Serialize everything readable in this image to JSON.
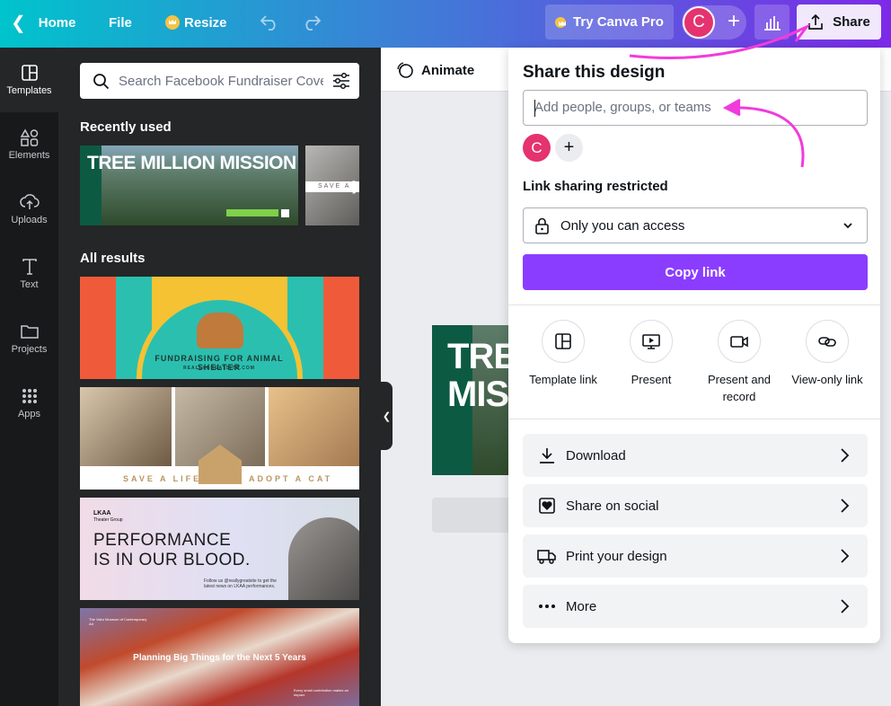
{
  "topbar": {
    "home_label": "Home",
    "file_label": "File",
    "resize_label": "Resize",
    "pro_label": "Try Canva Pro",
    "avatar_initial": "C",
    "share_label": "Share"
  },
  "rail": {
    "items": [
      {
        "label": "Templates",
        "icon": "templates-icon"
      },
      {
        "label": "Elements",
        "icon": "elements-icon"
      },
      {
        "label": "Uploads",
        "icon": "uploads-icon"
      },
      {
        "label": "Text",
        "icon": "text-icon"
      },
      {
        "label": "Projects",
        "icon": "folder-icon"
      },
      {
        "label": "Apps",
        "icon": "apps-grid-icon"
      }
    ]
  },
  "panel": {
    "search_placeholder": "Search Facebook Fundraiser Cove",
    "recent_title": "Recently used",
    "all_title": "All results",
    "recent1_text": "TREE MILLION MISSION",
    "recent2_text": "SAVE A",
    "t1_text": "FUNDRAISING FOR ANIMAL SHELTER",
    "t1_url": "REALLYGREATSITE.COM",
    "t2_left": "SAVE A LIFE",
    "t2_right": "ADOPT A CAT",
    "t3_logo": "LKAA",
    "t3_logo_sub": "Theater Group",
    "t3_headline_1": "PERFORMANCE",
    "t3_headline_2": "IS IN OUR BLOOD.",
    "t3_small": "Follow us @reallygreatsite to get the latest news on LKAA performances.",
    "t4_logo": "The Valro Museum of Contemporary Art",
    "t4_headline": "Planning Big Things for the Next 5 Years",
    "t4_small": "Every small contribution makes an impact."
  },
  "canvas": {
    "animate_label": "Animate",
    "page_text_1": "TRE",
    "page_text_2": "MIS"
  },
  "share": {
    "title": "Share this design",
    "people_placeholder": "Add people, groups, or teams",
    "avatar_initial": "C",
    "add_symbol": "+",
    "link_label": "Link sharing restricted",
    "access_value": "Only you can access",
    "copy_label": "Copy link",
    "options": [
      {
        "label": "Template link",
        "icon": "template-link-icon"
      },
      {
        "label": "Present",
        "icon": "present-icon"
      },
      {
        "label": "Present and record",
        "icon": "camera-icon"
      },
      {
        "label": "View-only link",
        "icon": "link-icon"
      }
    ],
    "rows": [
      {
        "label": "Download",
        "icon": "download-icon"
      },
      {
        "label": "Share on social",
        "icon": "heart-icon"
      },
      {
        "label": "Print your design",
        "icon": "truck-icon"
      },
      {
        "label": "More",
        "icon": "more-dots-icon"
      }
    ]
  },
  "colors": {
    "accent": "#8b3dff",
    "avatar": "#e4336f",
    "annotation": "#f23bdc"
  }
}
